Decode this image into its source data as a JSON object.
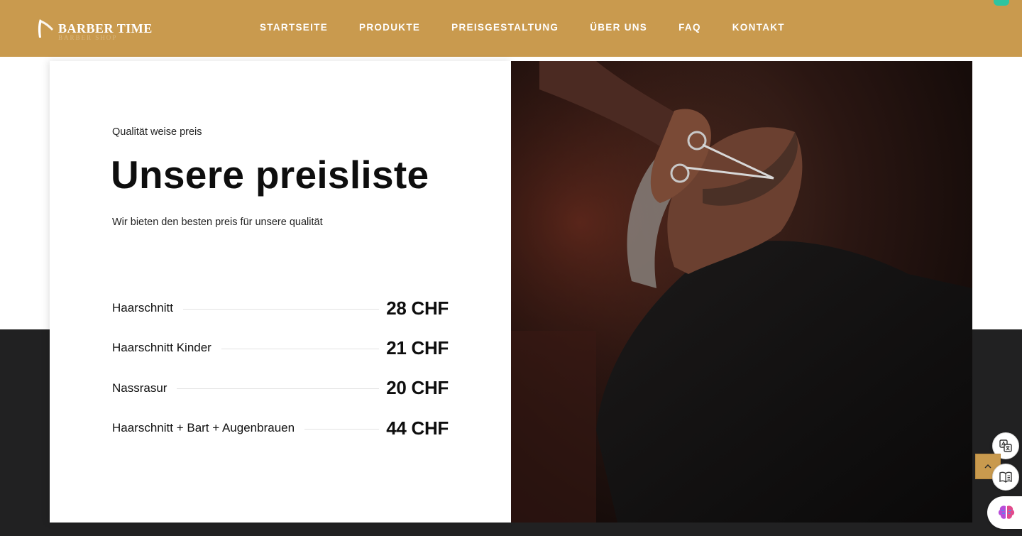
{
  "brand": {
    "name": "BARBER TIME",
    "sub": "BARBER SHOP"
  },
  "nav": {
    "items": [
      {
        "label": "STARTSEITE"
      },
      {
        "label": "PRODUKTE"
      },
      {
        "label": "PREISGESTALTUNG"
      },
      {
        "label": "ÜBER UNS"
      },
      {
        "label": "FAQ"
      },
      {
        "label": "KONTAKT"
      }
    ]
  },
  "pricing": {
    "eyebrow": "Qualität weise preis",
    "title": "Unsere preisliste",
    "subtitle": "Wir bieten den besten preis für unsere qualität",
    "items": [
      {
        "name": "Haarschnitt",
        "price": "28 CHF"
      },
      {
        "name": "Haarschnitt Kinder",
        "price": "21 CHF"
      },
      {
        "name": "Nassrasur",
        "price": "20 CHF"
      },
      {
        "name": "Haarschnitt + Bart + Augenbrauen",
        "price": "44 CHF"
      }
    ]
  },
  "colors": {
    "accent": "#c99a4e",
    "dark_section": "#212122",
    "text": "#0e0e0e"
  },
  "icons": {
    "logo": "razor-icon",
    "translate": "translate-icon",
    "scroll_top": "chevron-up-icon",
    "reader": "book-icon",
    "assistant": "brain-icon"
  }
}
